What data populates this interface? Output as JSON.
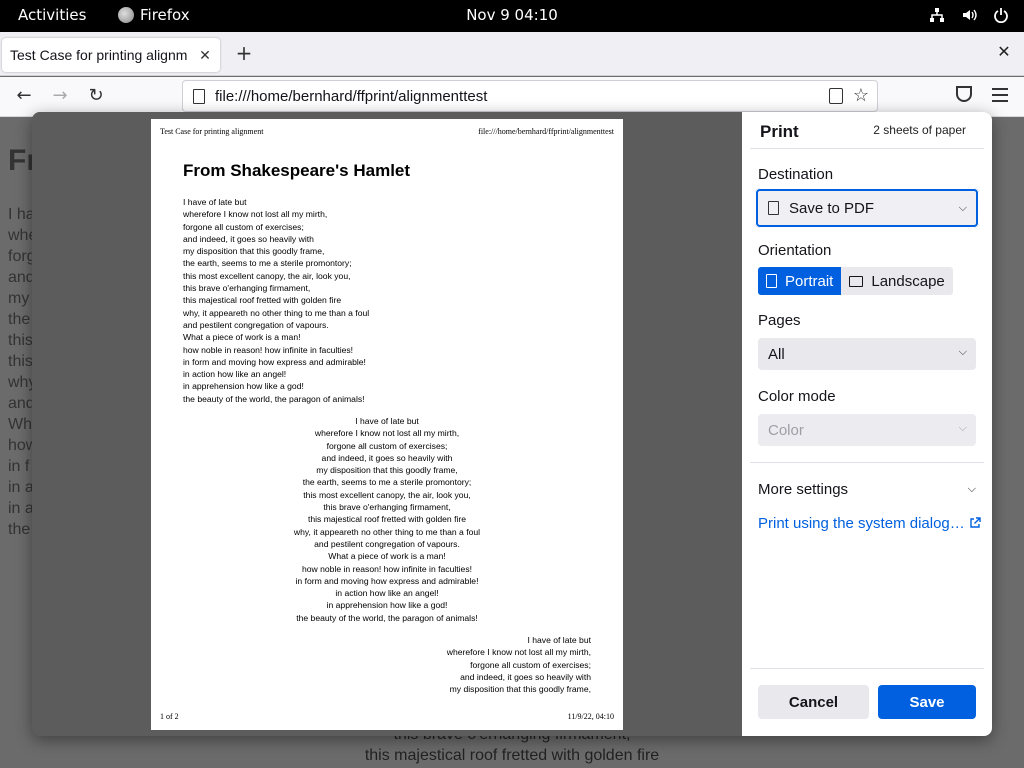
{
  "topbar": {
    "activities": "Activities",
    "app_name": "Firefox",
    "clock": "Nov 9  04:10",
    "tray_icons": [
      "network-icon",
      "volume-icon",
      "power-icon"
    ]
  },
  "browser": {
    "tab_title": "Test Case for printing alignm",
    "url": "file:///home/bernhard/ffprint/alignmenttest"
  },
  "background_page": {
    "heading_fragment": "Fr",
    "line_fragments": [
      "I ha",
      "whe",
      "forg",
      "and",
      "my",
      "the",
      "this",
      "this",
      "why",
      "and",
      "Wh",
      "how",
      "in f",
      "in a",
      "in a",
      "the"
    ],
    "bottom_lines": [
      "this brave o'erhanging firmament,",
      "this majestical roof fretted with golden fire"
    ]
  },
  "preview": {
    "header_left": "Test Case for printing alignment",
    "header_right": "file:///home/bernhard/ffprint/alignmenttest",
    "title": "From Shakespeare's Hamlet",
    "footer_left": "1 of 2",
    "footer_right": "11/9/22, 04:10",
    "poem_full": [
      "I have of late but",
      "wherefore I know not lost all my mirth,",
      "forgone all custom of exercises;",
      "and indeed, it goes so heavily with",
      "my disposition that this goodly frame,",
      "the earth, seems to me a sterile promontory;",
      "this most excellent canopy, the air, look you,",
      "this brave o'erhanging firmament,",
      "this majestical roof fretted with golden fire",
      "why, it appeareth no other thing to me than a foul",
      "and pestilent congregation of vapours.",
      "What a piece of work is a man!",
      "how noble in reason! how infinite in faculties!",
      "in form and moving how express and admirable!",
      "in action how like an angel!",
      "in apprehension how like a god!",
      "the beauty of the world, the paragon of animals!"
    ],
    "poem_partial": [
      "I have of late but",
      "wherefore I know not lost all my mirth,",
      "forgone all custom of exercises;",
      "and indeed, it goes so heavily with",
      "my disposition that this goodly frame,"
    ]
  },
  "print_panel": {
    "title": "Print",
    "sheets": "2 sheets of paper",
    "destination_label": "Destination",
    "destination_value": "Save to PDF",
    "orientation_label": "Orientation",
    "portrait": "Portrait",
    "landscape": "Landscape",
    "pages_label": "Pages",
    "pages_value": "All",
    "color_mode_label": "Color mode",
    "color_mode_value": "Color",
    "more_settings": "More settings",
    "system_dialog_link": "Print using the system dialog… ",
    "cancel": "Cancel",
    "save": "Save",
    "accent_color": "#0060df"
  }
}
